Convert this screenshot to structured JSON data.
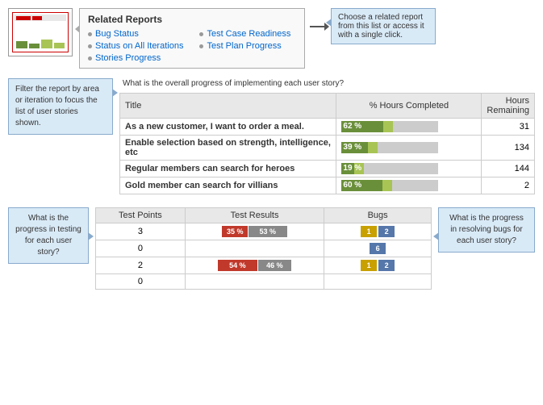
{
  "relatedReports": {
    "title": "Related Reports",
    "items": [
      {
        "label": "Bug Status"
      },
      {
        "label": "Status on All Iterations"
      },
      {
        "label": "Stories Progress"
      },
      {
        "label": "Test Case Readiness"
      },
      {
        "label": "Test Plan Progress"
      }
    ],
    "callout": "Choose a related report from this list or access it with a single click."
  },
  "filterCallout": "Filter the report by area or iteration to focus the list of user stories shown.",
  "progressCallout": "What is the overall progress of implementing each user story?",
  "storiesTable": {
    "headers": [
      "Title",
      "% Hours Completed",
      "Hours\nRemaining"
    ],
    "rows": [
      {
        "title": "As a new customer, I want to order a meal.",
        "pct": 62,
        "remaining": 31
      },
      {
        "title": "Enable selection based on strength, intelligence, etc",
        "pct": 39,
        "remaining": 134
      },
      {
        "title": "Regular members can search for heroes",
        "pct": 19,
        "remaining": 144
      },
      {
        "title": "Gold member can search for villians",
        "pct": 60,
        "remaining": 2
      }
    ]
  },
  "testingCallout": "What is the progress in testing for each user story?",
  "bugsCallout": "What is the progress in resolving bugs for each user story?",
  "testTable": {
    "headers": [
      "Test Points",
      "Test Results",
      "Bugs"
    ],
    "rows": [
      {
        "points": 3,
        "results": [
          {
            "pct": 35,
            "color": "red"
          },
          {
            "pct": 53,
            "color": "gray"
          }
        ],
        "bugs": [
          {
            "val": 1,
            "color": "yellow"
          },
          {
            "val": 2,
            "color": "blue"
          }
        ]
      },
      {
        "points": 0,
        "results": [],
        "bugs": [
          {
            "val": 6,
            "color": "blue"
          }
        ]
      },
      {
        "points": 2,
        "results": [
          {
            "pct": 54,
            "color": "red"
          },
          {
            "pct": 46,
            "color": "gray"
          }
        ],
        "bugs": [
          {
            "val": 1,
            "color": "yellow"
          },
          {
            "val": 2,
            "color": "blue"
          }
        ]
      },
      {
        "points": 0,
        "results": [],
        "bugs": []
      }
    ]
  }
}
